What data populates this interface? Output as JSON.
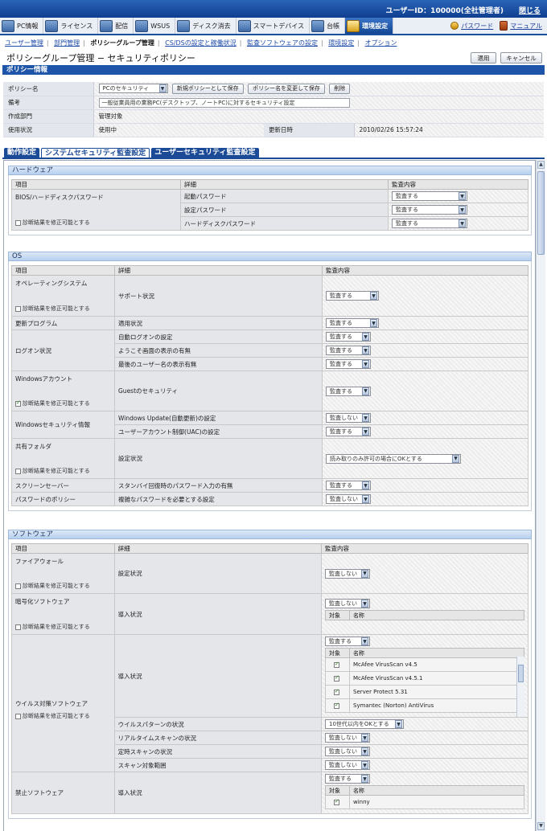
{
  "header": {
    "user_id": "ユーザーID：100000(全社管理者)",
    "logout": "閉じる"
  },
  "tabs": [
    {
      "label": "PC情報",
      "icon": "pc-icon"
    },
    {
      "label": "ライセンス",
      "icon": "license-icon"
    },
    {
      "label": "配信",
      "icon": "delivery-icon"
    },
    {
      "label": "WSUS",
      "icon": "wsus-icon"
    },
    {
      "label": "ディスク消去",
      "icon": "disk-erase-icon"
    },
    {
      "label": "スマートデバイス",
      "icon": "smart-device-icon"
    },
    {
      "label": "台帳",
      "icon": "ledger-icon"
    },
    {
      "label": "環境設定",
      "icon": "settings-icon",
      "active": true
    }
  ],
  "right_links": {
    "password": "パスワード",
    "manual": "マニュアル"
  },
  "subnav": [
    "ユーザー管理",
    "部門管理",
    "ポリシーグループ管理",
    "CS/DSの設定と稼働状況",
    "監査ソフトウェアの設定",
    "環境設定",
    "オプション"
  ],
  "page_title": "ポリシーグループ管理 − セキュリティポリシー",
  "buttons": {
    "apply": "適用",
    "cancel": "キャンセル"
  },
  "policy_info": {
    "header": "ポリシー情報",
    "name_label": "ポリシー名",
    "name_value": "PCのセキュリティ",
    "btn_save_new": "新規ポリシーとして保存",
    "btn_rename": "ポリシー名を変更して保存",
    "btn_delete": "削除",
    "remarks_label": "備考",
    "remarks_value": "一般従業員用の業務PC(デスクトップ、ノートPC)に対するセキュリティ設定",
    "dept_label": "作成部門",
    "dept_value": "管理対象",
    "status_label": "使用状況",
    "status_value": "使用中",
    "updated_label": "更新日時",
    "updated_value": "2010/02/26 15:57:24"
  },
  "content_tabs": [
    "動作設定",
    "システムセキュリティ監査設定",
    "ユーザーセキュリティ監査設定"
  ],
  "cols": {
    "item": "項目",
    "detail": "詳細",
    "audit": "監査内容"
  },
  "diag": "診断結果を修正可能とする",
  "hardware": {
    "title": "ハードウェア",
    "item": "BIOS/ハードディスクパスワード",
    "rows": [
      {
        "detail": "起動パスワード",
        "value": "監査する"
      },
      {
        "detail": "設定パスワード",
        "value": "監査する"
      },
      {
        "detail": "ハードディスクパスワード",
        "value": "監査する"
      }
    ]
  },
  "os": {
    "title": "OS",
    "os_item": "オペレーティングシステム",
    "support": "サポート状況",
    "support_val": "監査する",
    "update_item": "更新プログラム",
    "update_detail": "適用状況",
    "update_val": "監査する",
    "logon_item": "ログオン状況",
    "logon_rows": [
      {
        "detail": "自動ログオンの設定",
        "value": "監査する"
      },
      {
        "detail": "ようこそ画面の表示の有無",
        "value": "監査する"
      },
      {
        "detail": "最後のユーザー名の表示有無",
        "value": "監査する"
      }
    ],
    "winacct_item": "Windowsアカウント",
    "guest": "Guestのセキュリティ",
    "guest_val": "監査する",
    "winsec_item": "Windowsセキュリティ情報",
    "winsec_rows": [
      {
        "detail": "Windows Update(自動更新)の設定",
        "value": "監査しない"
      },
      {
        "detail": "ユーザーアカウント制御(UAC)の設定",
        "value": "監査する"
      }
    ],
    "share_item": "共有フォルダ",
    "share_detail": "設定状況",
    "share_val": "読み取りのみ許可の場合にOKとする",
    "screensaver_item": "スクリーンセーバー",
    "screensaver_detail": "スタンバイ回復時のパスワード入力の有無",
    "screensaver_val": "監査する",
    "pwpolicy_item": "パスワードのポリシー",
    "pwpolicy_detail": "複雑なパスワードを必要とする設定",
    "pwpolicy_val": "監査しない"
  },
  "software": {
    "title": "ソフトウェア",
    "fw_item": "ファイアウォール",
    "fw_detail": "設定状況",
    "fw_val": "監査しない",
    "enc_item": "暗号化ソフトウェア",
    "enc_detail": "導入状況",
    "enc_val": "監査しない",
    "mini_target": "対象",
    "mini_name": "名称",
    "av_item": "ウイルス対策ソフトウェア",
    "av_detail": "導入状況",
    "av_val": "監査する",
    "av_list": [
      "McAfee VirusScan v4.5",
      "McAfee VirusScan v4.5.1",
      "Server Protect 5.31",
      "Symantec (Norton) AntiVirus"
    ],
    "av_rows": [
      {
        "detail": "ウイルスパターンの状況",
        "value": "10世代以内をOKとする"
      },
      {
        "detail": "リアルタイムスキャンの状況",
        "value": "監査しない"
      },
      {
        "detail": "定時スキャンの状況",
        "value": "監査しない"
      },
      {
        "detail": "スキャン対象範囲",
        "value": "監査しない"
      }
    ],
    "ban_item": "禁止ソフトウェア",
    "ban_detail": "導入状況",
    "ban_val": "監査する",
    "ban_list": [
      "winny"
    ]
  }
}
